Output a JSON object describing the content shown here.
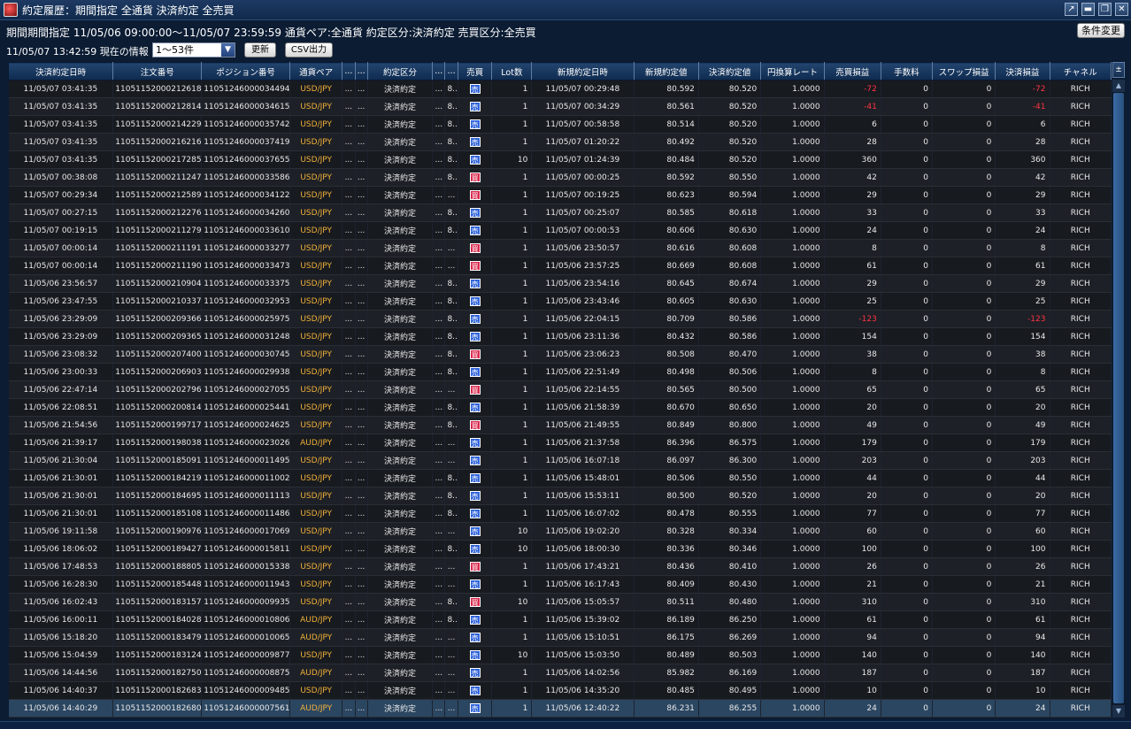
{
  "window": {
    "title": "約定履歴：期間指定 全通貨 決済約定 全売買",
    "buttons": [
      "↗",
      "▬",
      "❐",
      "✕"
    ]
  },
  "header": {
    "info": "期間期間指定  11/05/06 09:00:00～11/05/07 23:59:59   通貨ペア:全通貨   約定区分:決済約定   売買区分:全売買",
    "condition_button": "条件変更",
    "as_of": "11/05/07 13:42:59 現在の情報",
    "range_select": "1～53件",
    "refresh_button": "更新",
    "csv_button": "CSV出力"
  },
  "columns": [
    "決済約定日時",
    "注文番号",
    "ポジション番号",
    "通貨ペア",
    "...",
    "...",
    "約定区分",
    "...",
    "...",
    "売買",
    "Lot数",
    "新規約定日時",
    "新規約定値",
    "決済約定値",
    "円換算レート",
    "売買損益",
    "手数料",
    "スワップ損益",
    "決済損益",
    "チャネル"
  ],
  "rows": [
    [
      "11/05/07 03:41:35",
      "11051152000212618",
      "11051246000034494",
      "USD/JPY",
      "...",
      "...",
      "決済約定",
      "...",
      "8...",
      "売",
      "1",
      "11/05/07 00:29:48",
      "80.592",
      "80.520",
      "1.0000",
      "-72",
      "0",
      "0",
      "-72",
      "RICH"
    ],
    [
      "11/05/07 03:41:35",
      "11051152000212814",
      "11051246000034615",
      "USD/JPY",
      "...",
      "...",
      "決済約定",
      "...",
      "8...",
      "売",
      "1",
      "11/05/07 00:34:29",
      "80.561",
      "80.520",
      "1.0000",
      "-41",
      "0",
      "0",
      "-41",
      "RICH"
    ],
    [
      "11/05/07 03:41:35",
      "11051152000214229",
      "11051246000035742",
      "USD/JPY",
      "...",
      "...",
      "決済約定",
      "...",
      "8...",
      "売",
      "1",
      "11/05/07 00:58:58",
      "80.514",
      "80.520",
      "1.0000",
      "6",
      "0",
      "0",
      "6",
      "RICH"
    ],
    [
      "11/05/07 03:41:35",
      "11051152000216216",
      "11051246000037419",
      "USD/JPY",
      "...",
      "...",
      "決済約定",
      "...",
      "8...",
      "売",
      "1",
      "11/05/07 01:20:22",
      "80.492",
      "80.520",
      "1.0000",
      "28",
      "0",
      "0",
      "28",
      "RICH"
    ],
    [
      "11/05/07 03:41:35",
      "11051152000217285",
      "11051246000037655",
      "USD/JPY",
      "...",
      "...",
      "決済約定",
      "...",
      "8...",
      "売",
      "10",
      "11/05/07 01:24:39",
      "80.484",
      "80.520",
      "1.0000",
      "360",
      "0",
      "0",
      "360",
      "RICH"
    ],
    [
      "11/05/07 00:38:08",
      "11051152000211247",
      "11051246000033586",
      "USD/JPY",
      "...",
      "...",
      "決済約定",
      "...",
      "8...",
      "買",
      "1",
      "11/05/07 00:00:25",
      "80.592",
      "80.550",
      "1.0000",
      "42",
      "0",
      "0",
      "42",
      "RICH"
    ],
    [
      "11/05/07 00:29:34",
      "11051152000212589",
      "11051246000034122",
      "USD/JPY",
      "...",
      "...",
      "決済約定",
      "...",
      "...",
      "買",
      "1",
      "11/05/07 00:19:25",
      "80.623",
      "80.594",
      "1.0000",
      "29",
      "0",
      "0",
      "29",
      "RICH"
    ],
    [
      "11/05/07 00:27:15",
      "11051152000212276",
      "11051246000034260",
      "USD/JPY",
      "...",
      "...",
      "決済約定",
      "...",
      "8...",
      "売",
      "1",
      "11/05/07 00:25:07",
      "80.585",
      "80.618",
      "1.0000",
      "33",
      "0",
      "0",
      "33",
      "RICH"
    ],
    [
      "11/05/07 00:19:15",
      "11051152000211279",
      "11051246000033610",
      "USD/JPY",
      "...",
      "...",
      "決済約定",
      "...",
      "8...",
      "売",
      "1",
      "11/05/07 00:00:53",
      "80.606",
      "80.630",
      "1.0000",
      "24",
      "0",
      "0",
      "24",
      "RICH"
    ],
    [
      "11/05/07 00:00:14",
      "11051152000211191",
      "11051246000033277",
      "USD/JPY",
      "...",
      "...",
      "決済約定",
      "...",
      "...",
      "買",
      "1",
      "11/05/06 23:50:57",
      "80.616",
      "80.608",
      "1.0000",
      "8",
      "0",
      "0",
      "8",
      "RICH"
    ],
    [
      "11/05/07 00:00:14",
      "11051152000211190",
      "11051246000033473",
      "USD/JPY",
      "...",
      "...",
      "決済約定",
      "...",
      "...",
      "買",
      "1",
      "11/05/06 23:57:25",
      "80.669",
      "80.608",
      "1.0000",
      "61",
      "0",
      "0",
      "61",
      "RICH"
    ],
    [
      "11/05/06 23:56:57",
      "11051152000210904",
      "11051246000033375",
      "USD/JPY",
      "...",
      "...",
      "決済約定",
      "...",
      "8...",
      "売",
      "1",
      "11/05/06 23:54:16",
      "80.645",
      "80.674",
      "1.0000",
      "29",
      "0",
      "0",
      "29",
      "RICH"
    ],
    [
      "11/05/06 23:47:55",
      "11051152000210337",
      "11051246000032953",
      "USD/JPY",
      "...",
      "...",
      "決済約定",
      "...",
      "8...",
      "売",
      "1",
      "11/05/06 23:43:46",
      "80.605",
      "80.630",
      "1.0000",
      "25",
      "0",
      "0",
      "25",
      "RICH"
    ],
    [
      "11/05/06 23:29:09",
      "11051152000209366",
      "11051246000025975",
      "USD/JPY",
      "...",
      "...",
      "決済約定",
      "...",
      "8...",
      "売",
      "1",
      "11/05/06 22:04:15",
      "80.709",
      "80.586",
      "1.0000",
      "-123",
      "0",
      "0",
      "-123",
      "RICH"
    ],
    [
      "11/05/06 23:29:09",
      "11051152000209365",
      "11051246000031248",
      "USD/JPY",
      "...",
      "...",
      "決済約定",
      "...",
      "8...",
      "売",
      "1",
      "11/05/06 23:11:36",
      "80.432",
      "80.586",
      "1.0000",
      "154",
      "0",
      "0",
      "154",
      "RICH"
    ],
    [
      "11/05/06 23:08:32",
      "11051152000207400",
      "11051246000030745",
      "USD/JPY",
      "...",
      "...",
      "決済約定",
      "...",
      "8...",
      "買",
      "1",
      "11/05/06 23:06:23",
      "80.508",
      "80.470",
      "1.0000",
      "38",
      "0",
      "0",
      "38",
      "RICH"
    ],
    [
      "11/05/06 23:00:33",
      "11051152000206903",
      "11051246000029938",
      "USD/JPY",
      "...",
      "...",
      "決済約定",
      "...",
      "8...",
      "売",
      "1",
      "11/05/06 22:51:49",
      "80.498",
      "80.506",
      "1.0000",
      "8",
      "0",
      "0",
      "8",
      "RICH"
    ],
    [
      "11/05/06 22:47:14",
      "11051152000202796",
      "11051246000027055",
      "USD/JPY",
      "...",
      "...",
      "決済約定",
      "...",
      "...",
      "買",
      "1",
      "11/05/06 22:14:55",
      "80.565",
      "80.500",
      "1.0000",
      "65",
      "0",
      "0",
      "65",
      "RICH"
    ],
    [
      "11/05/06 22:08:51",
      "11051152000200814",
      "11051246000025441",
      "USD/JPY",
      "...",
      "...",
      "決済約定",
      "...",
      "8...",
      "売",
      "1",
      "11/05/06 21:58:39",
      "80.670",
      "80.650",
      "1.0000",
      "20",
      "0",
      "0",
      "20",
      "RICH"
    ],
    [
      "11/05/06 21:54:56",
      "11051152000199717",
      "11051246000024625",
      "USD/JPY",
      "...",
      "...",
      "決済約定",
      "...",
      "8...",
      "買",
      "1",
      "11/05/06 21:49:55",
      "80.849",
      "80.800",
      "1.0000",
      "49",
      "0",
      "0",
      "49",
      "RICH"
    ],
    [
      "11/05/06 21:39:17",
      "11051152000198038",
      "11051246000023026",
      "AUD/JPY",
      "...",
      "...",
      "決済約定",
      "...",
      "...",
      "売",
      "1",
      "11/05/06 21:37:58",
      "86.396",
      "86.575",
      "1.0000",
      "179",
      "0",
      "0",
      "179",
      "RICH"
    ],
    [
      "11/05/06 21:30:04",
      "11051152000185091",
      "11051246000011495",
      "USD/JPY",
      "...",
      "...",
      "決済約定",
      "...",
      "...",
      "売",
      "1",
      "11/05/06 16:07:18",
      "86.097",
      "86.300",
      "1.0000",
      "203",
      "0",
      "0",
      "203",
      "RICH"
    ],
    [
      "11/05/06 21:30:01",
      "11051152000184219",
      "11051246000011002",
      "USD/JPY",
      "...",
      "...",
      "決済約定",
      "...",
      "8...",
      "売",
      "1",
      "11/05/06 15:48:01",
      "80.506",
      "80.550",
      "1.0000",
      "44",
      "0",
      "0",
      "44",
      "RICH"
    ],
    [
      "11/05/06 21:30:01",
      "11051152000184695",
      "11051246000011113",
      "USD/JPY",
      "...",
      "...",
      "決済約定",
      "...",
      "8...",
      "売",
      "1",
      "11/05/06 15:53:11",
      "80.500",
      "80.520",
      "1.0000",
      "20",
      "0",
      "0",
      "20",
      "RICH"
    ],
    [
      "11/05/06 21:30:01",
      "11051152000185108",
      "11051246000011486",
      "USD/JPY",
      "...",
      "...",
      "決済約定",
      "...",
      "8...",
      "売",
      "1",
      "11/05/06 16:07:02",
      "80.478",
      "80.555",
      "1.0000",
      "77",
      "0",
      "0",
      "77",
      "RICH"
    ],
    [
      "11/05/06 19:11:58",
      "11051152000190976",
      "11051246000017069",
      "USD/JPY",
      "...",
      "...",
      "決済約定",
      "...",
      "...",
      "売",
      "10",
      "11/05/06 19:02:20",
      "80.328",
      "80.334",
      "1.0000",
      "60",
      "0",
      "0",
      "60",
      "RICH"
    ],
    [
      "11/05/06 18:06:02",
      "11051152000189427",
      "11051246000015811",
      "USD/JPY",
      "...",
      "...",
      "決済約定",
      "...",
      "8...",
      "売",
      "10",
      "11/05/06 18:00:30",
      "80.336",
      "80.346",
      "1.0000",
      "100",
      "0",
      "0",
      "100",
      "RICH"
    ],
    [
      "11/05/06 17:48:53",
      "11051152000188805",
      "11051246000015338",
      "USD/JPY",
      "...",
      "...",
      "決済約定",
      "...",
      "...",
      "買",
      "1",
      "11/05/06 17:43:21",
      "80.436",
      "80.410",
      "1.0000",
      "26",
      "0",
      "0",
      "26",
      "RICH"
    ],
    [
      "11/05/06 16:28:30",
      "11051152000185448",
      "11051246000011943",
      "USD/JPY",
      "...",
      "...",
      "決済約定",
      "...",
      "...",
      "売",
      "1",
      "11/05/06 16:17:43",
      "80.409",
      "80.430",
      "1.0000",
      "21",
      "0",
      "0",
      "21",
      "RICH"
    ],
    [
      "11/05/06 16:02:43",
      "11051152000183157",
      "11051246000009935",
      "USD/JPY",
      "...",
      "...",
      "決済約定",
      "...",
      "8...",
      "買",
      "10",
      "11/05/06 15:05:57",
      "80.511",
      "80.480",
      "1.0000",
      "310",
      "0",
      "0",
      "310",
      "RICH"
    ],
    [
      "11/05/06 16:00:11",
      "11051152000184028",
      "11051246000010806",
      "AUD/JPY",
      "...",
      "...",
      "決済約定",
      "...",
      "8...",
      "売",
      "1",
      "11/05/06 15:39:02",
      "86.189",
      "86.250",
      "1.0000",
      "61",
      "0",
      "0",
      "61",
      "RICH"
    ],
    [
      "11/05/06 15:18:20",
      "11051152000183479",
      "11051246000010065",
      "AUD/JPY",
      "...",
      "...",
      "決済約定",
      "...",
      "...",
      "売",
      "1",
      "11/05/06 15:10:51",
      "86.175",
      "86.269",
      "1.0000",
      "94",
      "0",
      "0",
      "94",
      "RICH"
    ],
    [
      "11/05/06 15:04:59",
      "11051152000183124",
      "11051246000009877",
      "USD/JPY",
      "...",
      "...",
      "決済約定",
      "...",
      "...",
      "売",
      "10",
      "11/05/06 15:03:50",
      "80.489",
      "80.503",
      "1.0000",
      "140",
      "0",
      "0",
      "140",
      "RICH"
    ],
    [
      "11/05/06 14:44:56",
      "11051152000182750",
      "11051246000008875",
      "AUD/JPY",
      "...",
      "...",
      "決済約定",
      "...",
      "...",
      "売",
      "1",
      "11/05/06 14:02:56",
      "85.982",
      "86.169",
      "1.0000",
      "187",
      "0",
      "0",
      "187",
      "RICH"
    ],
    [
      "11/05/06 14:40:37",
      "11051152000182683",
      "11051246000009485",
      "USD/JPY",
      "...",
      "...",
      "決済約定",
      "...",
      "...",
      "売",
      "1",
      "11/05/06 14:35:20",
      "80.485",
      "80.495",
      "1.0000",
      "10",
      "0",
      "0",
      "10",
      "RICH"
    ],
    [
      "11/05/06 14:40:29",
      "11051152000182680",
      "11051246000007561",
      "AUD/JPY",
      "...",
      "...",
      "決済約定",
      "...",
      "...",
      "売",
      "1",
      "11/05/06 12:40:22",
      "86.231",
      "86.255",
      "1.0000",
      "24",
      "0",
      "0",
      "24",
      "RICH"
    ]
  ],
  "scroll": {
    "up": "▲",
    "down": "▼"
  },
  "corner_button": "±",
  "colors": {
    "background": "#0b1c33",
    "pair": "#f2b13a",
    "negative": "#ff3344",
    "sell": "#2f63d9",
    "buy": "#d8284d",
    "selected_row": "#2b4661"
  }
}
